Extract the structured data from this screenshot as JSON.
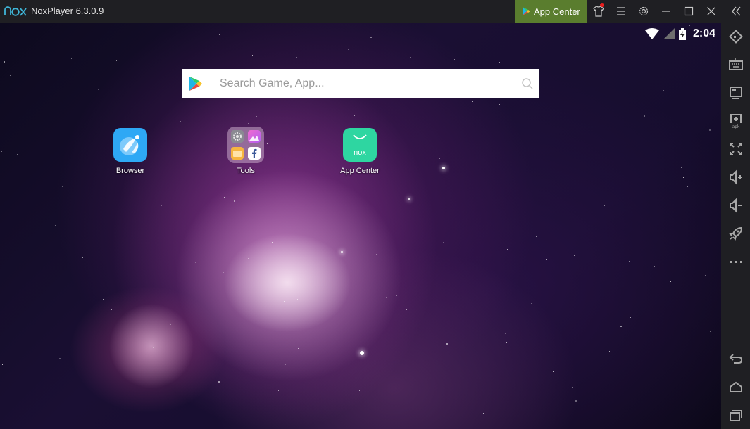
{
  "window": {
    "title": "NoxPlayer 6.3.0.9",
    "logo_text": "nox",
    "app_center_label": "App Center",
    "titlebar_icons": [
      "skin-icon",
      "menu-icon",
      "settings-icon",
      "minimize-icon",
      "maximize-icon",
      "close-icon",
      "collapse-sidebar-icon"
    ],
    "notification_dot": true
  },
  "colors": {
    "app_center_bg": "#5a7d2e",
    "titlebar_bg": "#1f1f23",
    "sidebar_icon": "#a8a8a8",
    "notification": "#e81e1e"
  },
  "status_bar": {
    "time": "2:04",
    "wifi": "full",
    "cellular": "no-signal",
    "battery": "charging"
  },
  "search": {
    "placeholder": "Search Game, App...",
    "value": ""
  },
  "desktop_icons": [
    {
      "label": "Browser",
      "icon": "browser-icon"
    },
    {
      "label": "Tools",
      "icon": "tools-folder-icon"
    },
    {
      "label": "App Center",
      "icon": "app-center-icon",
      "icon_text": "nox"
    }
  ],
  "sidebar": {
    "items": [
      {
        "name": "rotate",
        "icon": "rotate-screen-icon"
      },
      {
        "name": "keyboard",
        "icon": "keyboard-icon"
      },
      {
        "name": "screen",
        "icon": "screen-icon"
      },
      {
        "name": "apk",
        "icon": "add-apk-icon",
        "icon_text": "apk"
      },
      {
        "name": "fullscreen",
        "icon": "fullscreen-icon"
      },
      {
        "name": "volume-up",
        "icon": "volume-up-icon"
      },
      {
        "name": "volume-down",
        "icon": "volume-down-icon"
      },
      {
        "name": "boost",
        "icon": "rocket-icon"
      },
      {
        "name": "more",
        "icon": "more-icon"
      }
    ],
    "nav": [
      {
        "name": "back",
        "icon": "back-icon"
      },
      {
        "name": "home",
        "icon": "home-icon"
      },
      {
        "name": "recents",
        "icon": "recents-icon"
      }
    ]
  }
}
